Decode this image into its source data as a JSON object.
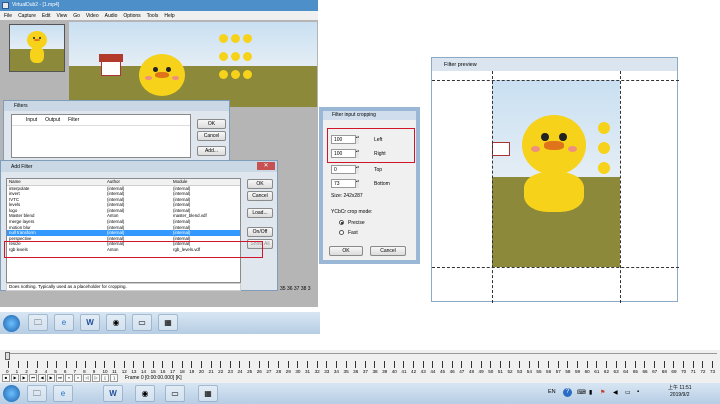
{
  "main_window": {
    "title": "VirtualDub2 - [1.mp4]",
    "menu": [
      "File",
      "Capture",
      "Edit",
      "View",
      "Go",
      "Video",
      "Audio",
      "Options",
      "Tools",
      "Help"
    ]
  },
  "filters_dialog": {
    "title": "Filters",
    "columns": [
      "Input",
      "Output",
      "Filter"
    ],
    "buttons": {
      "ok": "OK",
      "cancel": "Cancel",
      "add": "Add..."
    }
  },
  "add_filter": {
    "title": "Add Filter",
    "columns": {
      "name": "Name",
      "author": "Author",
      "module": "Module"
    },
    "rows": [
      {
        "name": "interpolate",
        "author": "(internal)",
        "module": "(internal)"
      },
      {
        "name": "invert",
        "author": "(internal)",
        "module": "(internal)"
      },
      {
        "name": "IVTC",
        "author": "(internal)",
        "module": "(internal)"
      },
      {
        "name": "levels",
        "author": "(internal)",
        "module": "(internal)"
      },
      {
        "name": "logo",
        "author": "(internal)",
        "module": "(internal)"
      },
      {
        "name": "Master blend",
        "author": "Anton",
        "module": "master_blend.vdf"
      },
      {
        "name": "merge layers",
        "author": "(internal)",
        "module": "(internal)"
      },
      {
        "name": "motion blur",
        "author": "(internal)",
        "module": "(internal)"
      },
      {
        "name": "null transform",
        "author": "(internal)",
        "module": "(internal)"
      },
      {
        "name": "perspective",
        "author": "(internal)",
        "module": "(internal)"
      },
      {
        "name": "resize",
        "author": "(internal)",
        "module": "(internal)"
      },
      {
        "name": "rgb levels",
        "author": "Anton",
        "module": "rgb_levels.vdf"
      }
    ],
    "selected_index": 8,
    "description": "Does nothing. Typically used as a placeholder for cropping.",
    "buttons": {
      "ok": "OK",
      "cancel": "Cancel",
      "load": "Load...",
      "onoff": "On/Off",
      "showall": "Show All"
    }
  },
  "crop_dialog": {
    "title": "Filter input cropping",
    "left": {
      "value": "100",
      "label": "Left"
    },
    "right": {
      "value": "100",
      "label": "Right"
    },
    "top": {
      "value": "0",
      "label": "Top"
    },
    "bottom": {
      "value": "73",
      "label": "Bottom"
    },
    "size": "Size: 242x287",
    "mode_label": "YCbCr crop mode:",
    "modes": [
      {
        "label": "Precise",
        "selected": true
      },
      {
        "label": "Fast",
        "selected": false
      }
    ],
    "buttons": {
      "ok": "OK",
      "cancel": "Cancel"
    }
  },
  "preview": {
    "title": "Filter preview"
  },
  "timeline": {
    "frame_text": "Frame 0 [0:00:00.000] [K]",
    "ticks": [
      "0",
      "1",
      "2",
      "3",
      "4",
      "5",
      "6",
      "7",
      "8",
      "9",
      "10",
      "11",
      "12",
      "13",
      "14",
      "15",
      "16",
      "17",
      "18",
      "19",
      "20",
      "21",
      "22",
      "23",
      "24",
      "25",
      "26",
      "27",
      "28",
      "29",
      "30",
      "31",
      "32",
      "33",
      "34",
      "35",
      "36",
      "37",
      "38",
      "39",
      "40",
      "41",
      "42",
      "43",
      "44",
      "45",
      "46",
      "47",
      "48",
      "49",
      "50",
      "51",
      "52",
      "53",
      "54",
      "55",
      "56",
      "57",
      "58",
      "59",
      "60",
      "61",
      "62",
      "63",
      "64",
      "65",
      "66",
      "67",
      "68",
      "69",
      "70",
      "71",
      "72",
      "73"
    ],
    "partial_scale": "35 36 37 38 3"
  },
  "taskbar": {
    "language": "EN",
    "time": "上午 11:51",
    "date": "2019/9/2",
    "icons": [
      "start-orb",
      "file-explorer",
      "internet-explorer",
      "word",
      "chrome",
      "media-player",
      "capture-tool"
    ]
  }
}
